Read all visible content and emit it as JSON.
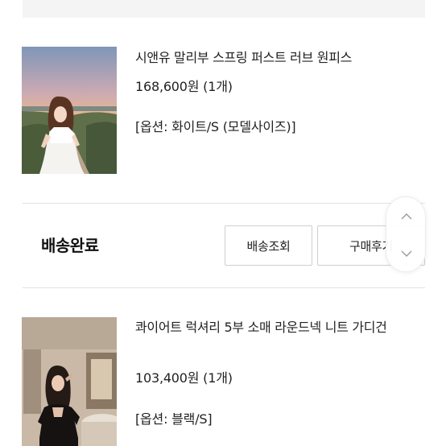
{
  "orders": [
    {
      "name": "시앤유 말리부 스프링 퍼스트 러브 원피스",
      "price": "168,600원 (1개)",
      "option": "[옵션: 화이트/S (모델사이즈)]",
      "image": "photo-model-white-dress-sunset"
    },
    {
      "name": "콰이어트 럭셔리 5부 소매 라운드넥 니트 가디건",
      "price": "103,400원 (1개)",
      "option": "[옵션: 블랙/S]",
      "image": "photo-model-black-cardigan-interior"
    }
  ],
  "delivery": {
    "status": "배송완료",
    "track_button": "배송조회",
    "review_button": "구매후기"
  },
  "scroll_widget": {
    "up_icon": "chevron-up-icon",
    "down_icon": "chevron-down-icon"
  }
}
